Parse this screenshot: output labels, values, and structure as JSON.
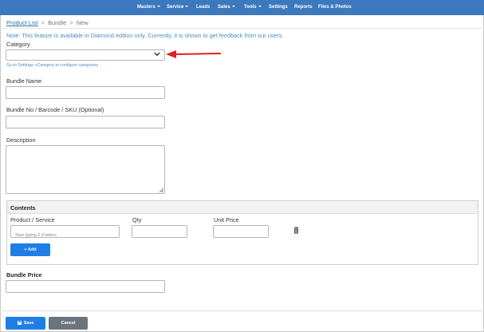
{
  "nav": {
    "items": [
      {
        "label": "Masters",
        "dropdown": true
      },
      {
        "label": "Service",
        "dropdown": true
      },
      {
        "label": "Leads",
        "dropdown": false
      },
      {
        "label": "Sales",
        "dropdown": true
      },
      {
        "label": "Tools",
        "dropdown": true
      },
      {
        "label": "Settings",
        "dropdown": false
      },
      {
        "label": "Reports",
        "dropdown": false
      },
      {
        "label": "Files & Photos",
        "dropdown": false
      }
    ],
    "background": "#3b78bd"
  },
  "breadcrumb": {
    "product_list": "Product List",
    "separator": ">",
    "bundle": "Bundle",
    "new": "New"
  },
  "note": "Note: This feature is available in Diamond edition only. Currently, it is shown to get feedback from our users.",
  "form": {
    "category_label": "Category",
    "category_value": "",
    "category_helper": "Go to Settings->Category to configure categories",
    "bundle_name_label": "Bundle Name",
    "bundle_name_value": "",
    "bundle_no_label": "Bundle No / Barcode / SKU (Optional)",
    "bundle_no_value": "",
    "description_label": "Description",
    "description_value": "",
    "bundle_price_label": "Bundle Price",
    "bundle_price_value": ""
  },
  "contents": {
    "title": "Contents",
    "columns": [
      "Product / Service",
      "Qty",
      "Unit Price"
    ],
    "rows": [
      {
        "product_placeholder": "Start typing 2-3 letters",
        "qty": "",
        "unit_price": ""
      }
    ],
    "add_label": "+ Add"
  },
  "actions": {
    "save_label": "Save",
    "cancel_label": "Cancel"
  },
  "annotation": {
    "arrow_color": "#e02020"
  },
  "colors": {
    "primary_button": "#1e7ee6",
    "secondary_button": "#6c757d",
    "link": "#4a8cc6"
  }
}
